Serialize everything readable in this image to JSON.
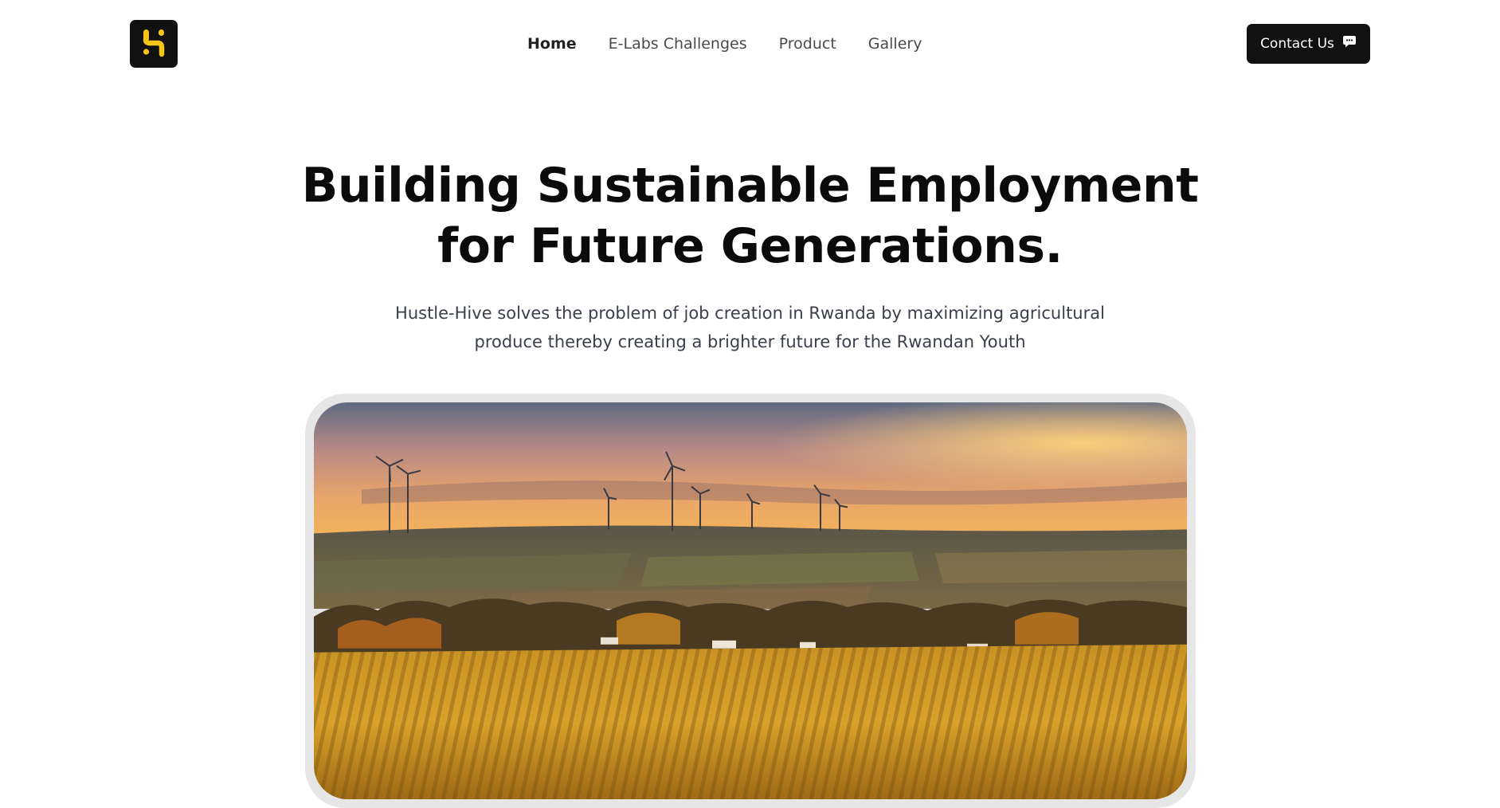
{
  "header": {
    "logo_icon": "hustle-hive-logo-icon",
    "logo_colors": {
      "background": "#111111",
      "mark": "#F5C518"
    },
    "nav": [
      {
        "label": "Home",
        "active": true
      },
      {
        "label": "E-Labs Challenges",
        "active": false
      },
      {
        "label": "Product",
        "active": false
      },
      {
        "label": "Gallery",
        "active": false
      }
    ],
    "contact": {
      "label": "Contact Us",
      "icon": "chat-bubble-icon"
    }
  },
  "hero": {
    "title_line1": "Building Sustainable Employment",
    "title_line2": "for Future Generations.",
    "subtitle_line1": "Hustle-Hive solves the problem of job creation in Rwanda by maximizing agricultural",
    "subtitle_line2": "produce thereby creating a brighter future for the Rwandan Youth"
  },
  "colors": {
    "accent": "#F5C518",
    "dark": "#111111",
    "frame": "#E6E6E6"
  }
}
